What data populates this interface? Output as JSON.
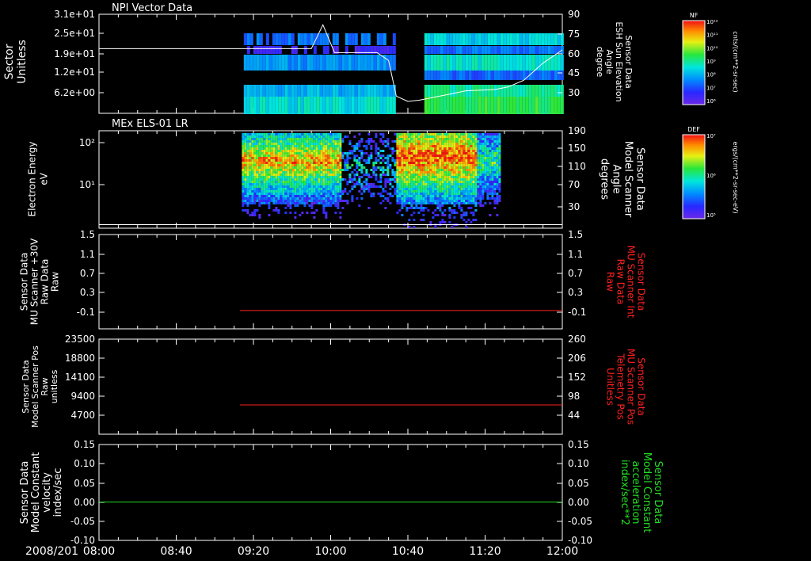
{
  "window": {
    "date_label": "2008/201"
  },
  "colors": {
    "background": "#000000",
    "axes": "#ffffff",
    "red_trace": "#ff2020",
    "green_trace": "#22dd22",
    "overlay": "#ffffff"
  },
  "time_axis": {
    "start": "08:00",
    "end": "12:00",
    "ticks": [
      "08:00",
      "08:40",
      "09:20",
      "10:00",
      "10:40",
      "11:20",
      "12:00"
    ]
  },
  "chart_data": [
    {
      "type": "heatmap",
      "title": "NPI Vector Data",
      "ylabel": "Sector Unitless",
      "y_ticks": [
        "3.1e+01",
        "2.5e+01",
        "1.9e+01",
        "1.2e+01",
        "6.2e+00"
      ],
      "ylabel_right": [
        "Sensor Data",
        "ESH Sun Elevation",
        "Angle",
        "degree"
      ],
      "y2_ticks": [
        "90",
        "75",
        "60",
        "45",
        "30"
      ],
      "y2lim": [
        15,
        90
      ],
      "overlay_line": {
        "points": [
          [
            "08:00",
            64
          ],
          [
            "09:50",
            64
          ],
          [
            "09:56",
            82
          ],
          [
            "10:02",
            61
          ],
          [
            "10:24",
            61
          ],
          [
            "10:30",
            55
          ],
          [
            "10:34",
            28
          ],
          [
            "10:40",
            24
          ],
          [
            "10:46",
            25
          ],
          [
            "11:00",
            29
          ],
          [
            "11:10",
            32
          ],
          [
            "11:25",
            33
          ],
          [
            "11:32",
            35
          ],
          [
            "11:40",
            40
          ],
          [
            "11:50",
            53
          ],
          [
            "12:00",
            63
          ]
        ]
      },
      "data_window": [
        "09:15",
        "12:00"
      ],
      "gap": [
        "10:33",
        "10:47"
      ],
      "colorbar": {
        "label": "NF",
        "units": "cnts/(cm**2-sr-sec)",
        "ticks": [
          "10¹²",
          "10¹¹",
          "10¹⁰",
          "10⁹",
          "10⁸",
          "10⁷",
          "10⁶"
        ]
      },
      "grid": false
    },
    {
      "type": "heatmap",
      "title": "MEx ELS-01 LR",
      "ylabel": [
        "Electron Energy",
        "eV"
      ],
      "y_ticks": [
        "10²",
        "10¹"
      ],
      "ylabel_right": [
        "Sensor Data",
        "Model Scanner",
        "Angle",
        "degrees"
      ],
      "y2_ticks": [
        "190",
        "150",
        "110",
        "70",
        "30"
      ],
      "y2lim": [
        0,
        190
      ],
      "overlay_line": {
        "points": [
          [
            "08:00",
            7
          ],
          [
            "12:00",
            7
          ]
        ]
      },
      "data_window": [
        "09:14",
        "11:27"
      ],
      "colorbar": {
        "label": "DEF",
        "units": "ergs/(cm**2-sr-sec-eV)",
        "ticks": [
          "10⁷",
          "10⁶",
          "10⁵"
        ]
      },
      "grid": false
    },
    {
      "type": "line",
      "ylabel": [
        "Sensor Data",
        "MU Scanner +30V",
        "Raw Data",
        "Raw"
      ],
      "y_ticks": [
        "1.5",
        "1.1",
        "0.7",
        "0.3",
        "-0.1"
      ],
      "ylim": [
        -0.35,
        1.5
      ],
      "ylabel_right": [
        "Sensor Data",
        "MU Scanner Int",
        "Raw Data",
        "Raw"
      ],
      "y2_ticks": [
        "1.5",
        "1.1",
        "0.7",
        "0.3",
        "-0.1"
      ],
      "series": [
        {
          "color": "red",
          "x": [
            "09:13",
            "12:00"
          ],
          "values": [
            0.01,
            0.01
          ]
        }
      ],
      "grid": false
    },
    {
      "type": "line",
      "ylabel": [
        "Sensor Data",
        "Model Scanner Pos",
        "Raw",
        "unitless"
      ],
      "y_ticks": [
        "23500",
        "18800",
        "14100",
        "9400",
        "4700"
      ],
      "ylim": [
        1150,
        23500
      ],
      "ylabel_right": [
        "Sensor Data",
        "MU Scanner Pos",
        "Telemetry Pos",
        "Unitless"
      ],
      "y2_ticks": [
        "260",
        "206",
        "152",
        "98",
        "44"
      ],
      "series": [
        {
          "color": "red",
          "x": [
            "09:13",
            "12:00"
          ],
          "values": [
            8050,
            8050
          ]
        }
      ],
      "grid": false
    },
    {
      "type": "line",
      "ylabel": [
        "Sensor Data",
        "Model Constant",
        "velocity",
        "index/sec"
      ],
      "y_ticks": [
        "0.15",
        "0.10",
        "0.05",
        "0.00",
        "-0.05",
        "-0.10"
      ],
      "ylim": [
        -0.1,
        0.15
      ],
      "ylabel_right": [
        "Sensor Data",
        "Model Constant",
        "acceleration",
        "index/sec**2"
      ],
      "y2_ticks": [
        "0.15",
        "0.10",
        "0.05",
        "0.00",
        "-0.05",
        "-0.10"
      ],
      "series": [
        {
          "color": "green",
          "x": [
            "08:00",
            "12:00"
          ],
          "values": [
            0.0,
            0.0
          ]
        }
      ],
      "grid": false
    }
  ]
}
